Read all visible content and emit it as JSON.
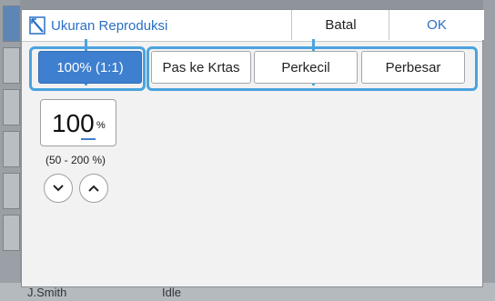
{
  "dialog": {
    "title": "Ukuran Reproduksi",
    "cancel_label": "Batal",
    "ok_label": "OK"
  },
  "options": [
    {
      "label": "100% (1:1)",
      "selected": true
    },
    {
      "label": "Pas ke Krtas",
      "selected": false
    },
    {
      "label": "Perkecil",
      "selected": false
    },
    {
      "label": "Perbesar",
      "selected": false
    }
  ],
  "zoom": {
    "value": "100",
    "unit": "%",
    "range": "(50 - 200 %)"
  },
  "background": {
    "user": "J.Smith",
    "status": "Idle"
  },
  "colors": {
    "accent": "#3e7fcf",
    "callout": "#4ba3de",
    "title_text": "#2a6fc4"
  },
  "icons": [
    "reproduction-size-icon",
    "chevron-down-icon",
    "chevron-up-icon"
  ]
}
